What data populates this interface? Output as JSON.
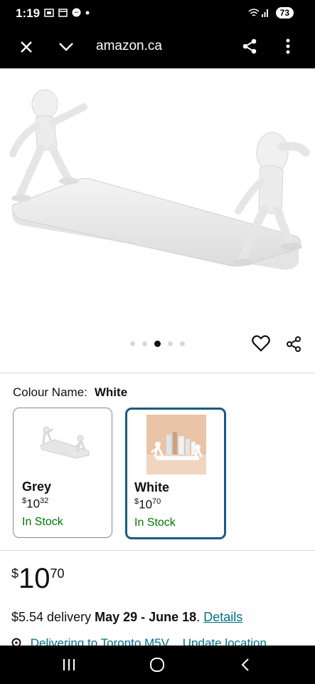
{
  "status": {
    "time": "1:19",
    "battery": "73"
  },
  "browser": {
    "url": "amazon.ca"
  },
  "gallery": {
    "dot_count": 5,
    "active_index": 2
  },
  "product": {
    "colour_label": "Colour Name:",
    "colour_value": "White",
    "variants": [
      {
        "name": "Grey",
        "currency": "$",
        "whole": "10",
        "fraction": "32",
        "stock": "In Stock",
        "selected": false
      },
      {
        "name": "White",
        "currency": "$",
        "whole": "10",
        "fraction": "70",
        "stock": "In Stock",
        "selected": true
      }
    ],
    "price": {
      "currency": "$",
      "whole": "10",
      "fraction": "70"
    },
    "delivery": {
      "fee": "$5.54 delivery",
      "dates": "May 29 - June 18",
      "period": ".",
      "details_link": "Details"
    },
    "location": {
      "text": "Delivering to Toronto M5V",
      "update": "Update location"
    }
  },
  "colors": {
    "accent": "#1a5a84",
    "link": "#007185",
    "stock": "#007600"
  }
}
